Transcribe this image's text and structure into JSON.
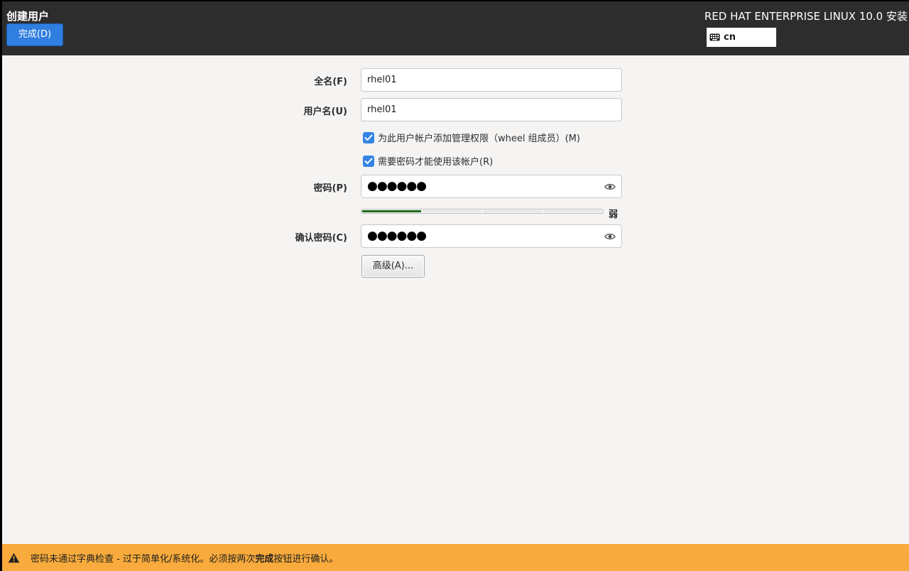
{
  "header": {
    "page_title": "创建用户",
    "done_label": "完成(D)",
    "product_title": "RED HAT ENTERPRISE LINUX 10.0 安装",
    "keyboard_layout": "cn",
    "keyboard_icon": "keyboard-icon"
  },
  "form": {
    "fullname_label": "全名(F)",
    "fullname_value": "rhel01",
    "username_label": "用户名(U)",
    "username_value": "rhel01",
    "admin_checkbox_label": "为此用户帐户添加管理权限（wheel 组成员）(M)",
    "admin_checked": true,
    "require_password_label": "需要密码才能使用该帐户(R)",
    "require_password_checked": true,
    "password_label": "密码(P)",
    "password_mask": "●●●●●●",
    "strength_segments_filled": 1,
    "strength_segments_total": 4,
    "strength_text": "弱",
    "confirm_label": "确认密码(C)",
    "confirm_mask": "●●●●●●",
    "advanced_label": "高级(A)..."
  },
  "status": {
    "prefix": "密码未通过字典检查 - 过于简单化/系统化。必须按两次",
    "bold": "完成",
    "suffix": "按钮进行确认。",
    "icon": "warning-icon",
    "color": "#f8ab3c"
  },
  "colors": {
    "header_bg": "#2d2d2d",
    "accent": "#2f7ee0",
    "checkbox": "#3584e4",
    "strength_fill": "#1d6b1d"
  }
}
